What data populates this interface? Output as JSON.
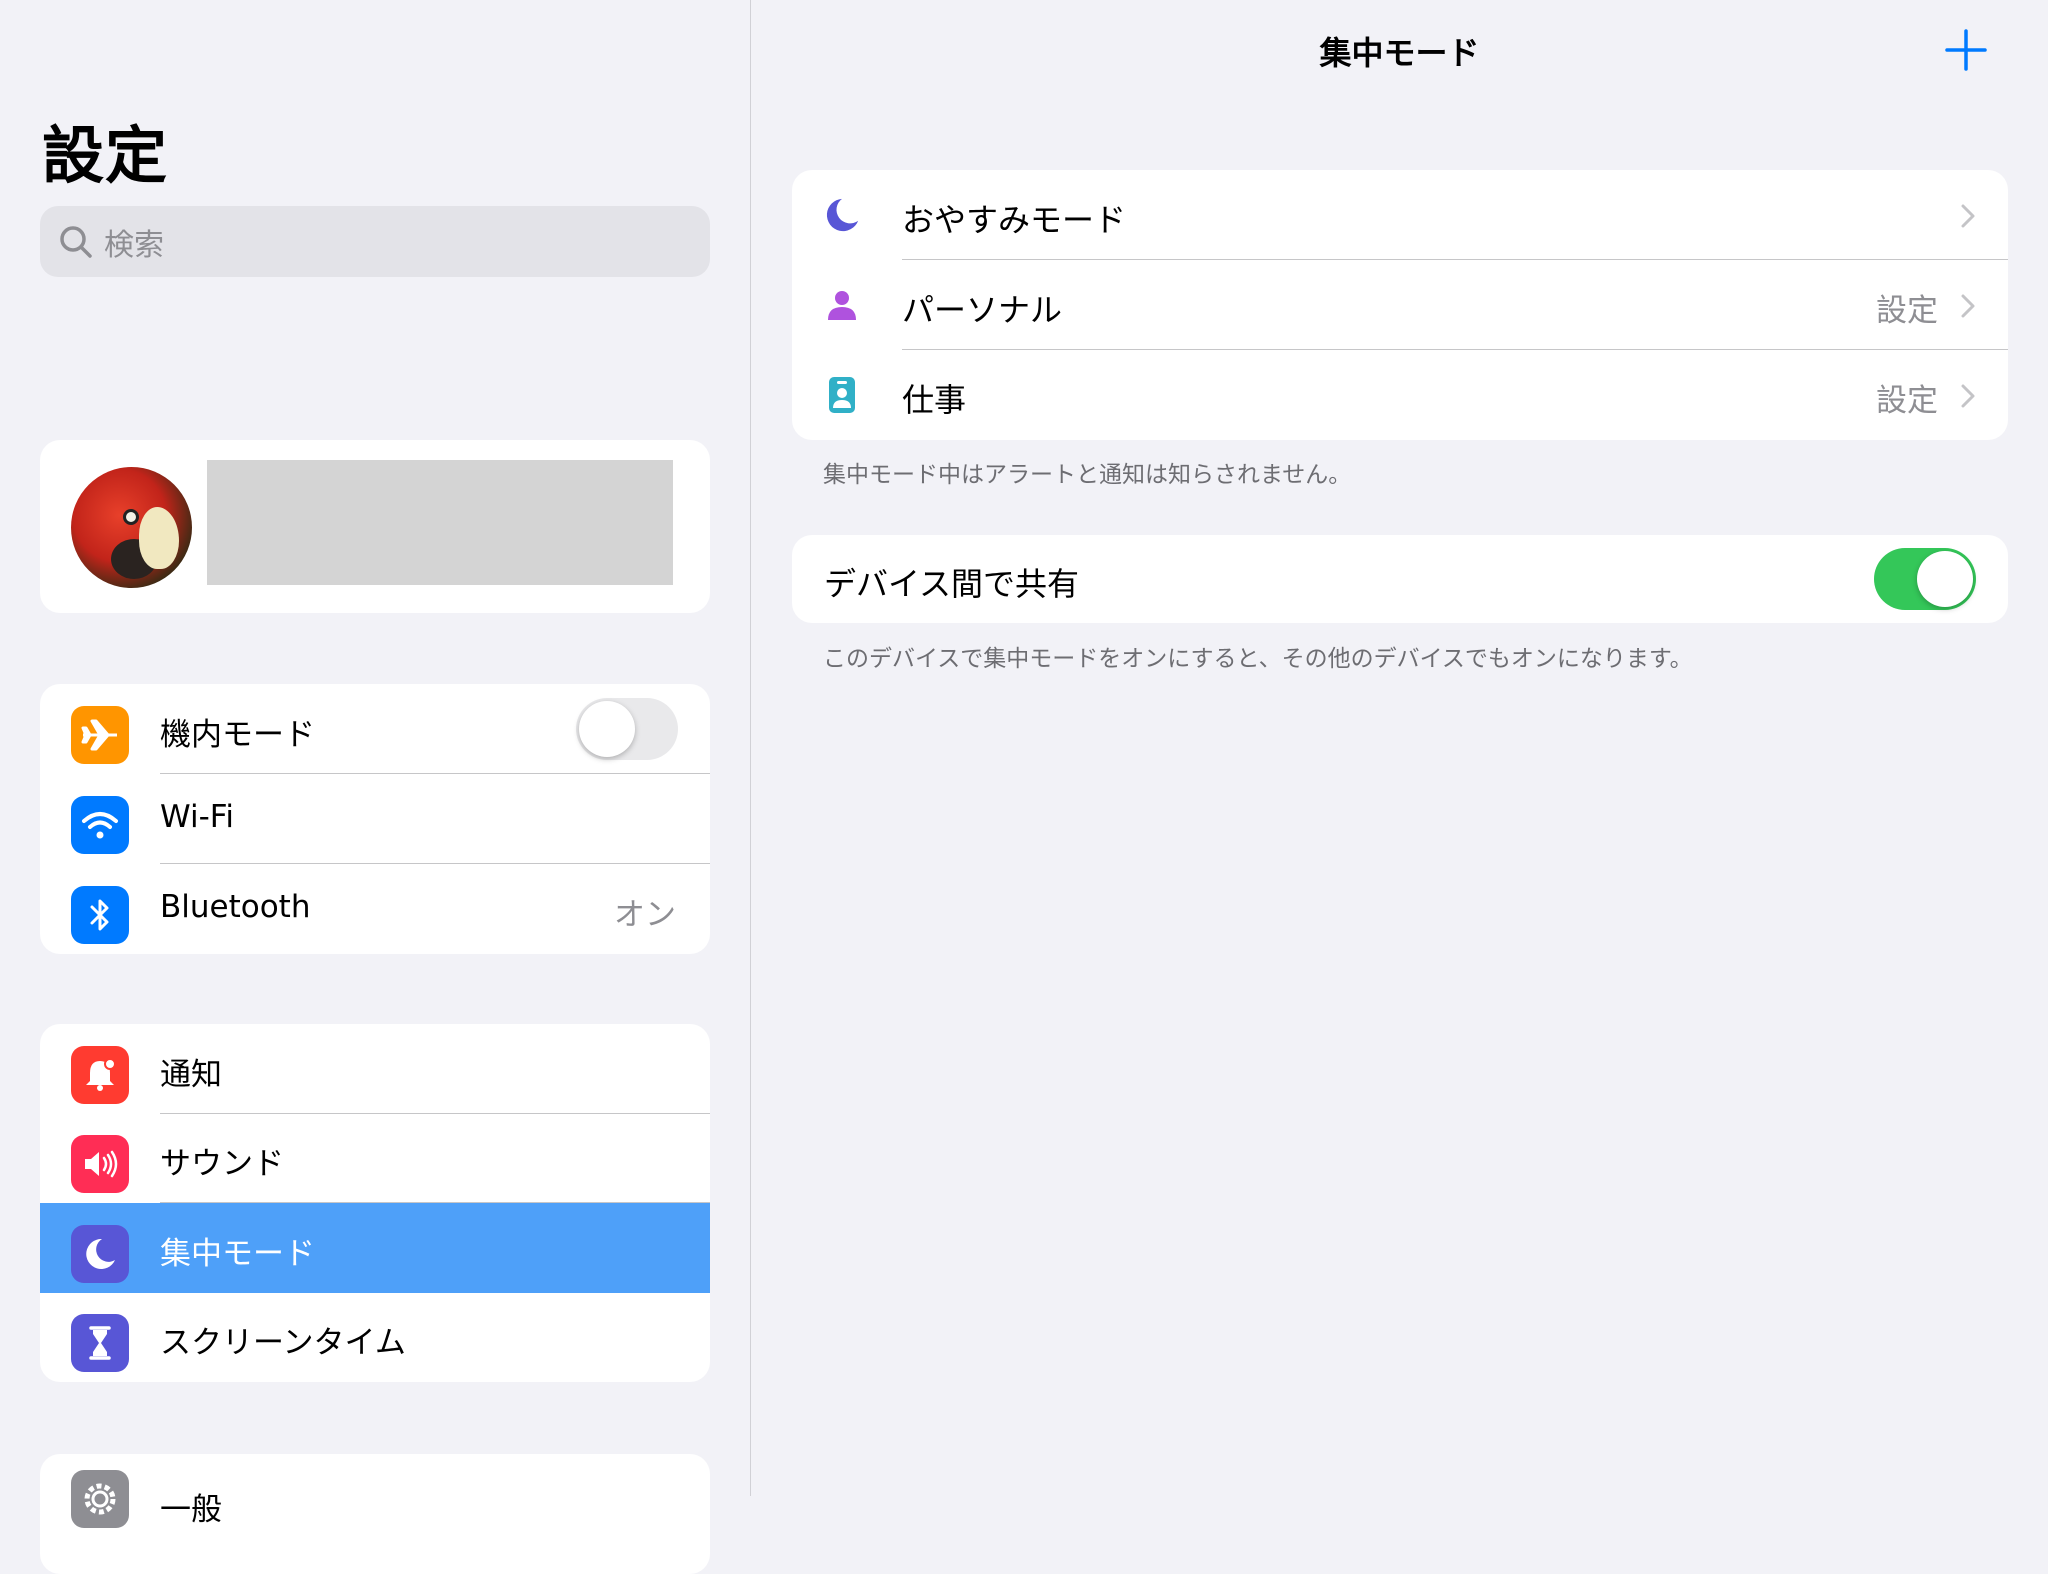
{
  "sidebar": {
    "title": "設定",
    "search_placeholder": "検索",
    "connectivity": [
      {
        "label": "機内モード",
        "icon": "airplane-icon",
        "color": "#ff9500",
        "toggle": false
      },
      {
        "label": "Wi-Fi",
        "icon": "wifi-icon",
        "color": "#007aff"
      },
      {
        "label": "Bluetooth",
        "icon": "bluetooth-icon",
        "color": "#007aff",
        "value": "オン"
      }
    ],
    "notifications_group": [
      {
        "label": "通知",
        "icon": "notification-bell-icon",
        "color": "#ff3b30"
      },
      {
        "label": "サウンド",
        "icon": "speaker-icon",
        "color": "#ff2d55"
      },
      {
        "label": "集中モード",
        "icon": "moon-icon",
        "color": "#5856d6",
        "selected": true
      },
      {
        "label": "スクリーンタイム",
        "icon": "hourglass-icon",
        "color": "#5856d6"
      }
    ],
    "general": {
      "label": "一般",
      "icon": "gear-icon",
      "color": "#8e8e93"
    }
  },
  "detail": {
    "title": "集中モード",
    "add_icon": "plus-icon",
    "focus_modes": [
      {
        "label": "おやすみモード",
        "icon": "moon-icon",
        "color": "#5856d6",
        "value": ""
      },
      {
        "label": "パーソナル",
        "icon": "person-icon",
        "color": "#af52de",
        "value": "設定"
      },
      {
        "label": "仕事",
        "icon": "id-badge-icon",
        "color": "#30b0c7",
        "value": "設定"
      }
    ],
    "modes_footer": "集中モード中はアラートと通知は知らされません。",
    "share": {
      "label": "デバイス間で共有",
      "toggle": true
    },
    "share_footer": "このデバイスで集中モードをオンにすると、その他のデバイスでもオンになります。"
  }
}
